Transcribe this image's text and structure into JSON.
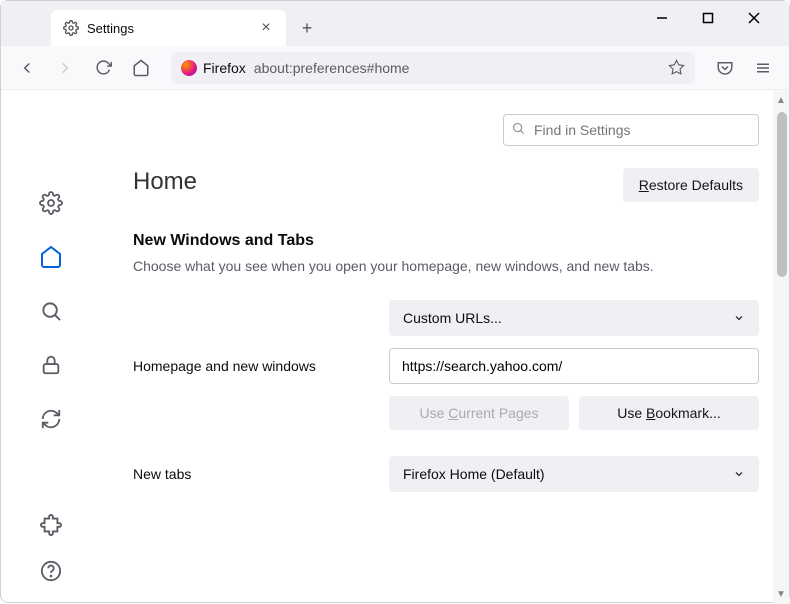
{
  "titlebar": {
    "tab_title": "Settings"
  },
  "navbar": {
    "identity_label": "Firefox",
    "url": "about:preferences#home"
  },
  "search": {
    "placeholder": "Find in Settings"
  },
  "page": {
    "title": "Home",
    "restore_btn": "Restore Defaults",
    "section_heading": "New Windows and Tabs",
    "section_desc": "Choose what you see when you open your homepage, new windows, and new tabs.",
    "homepage_label": "Homepage and new windows",
    "homepage_mode": "Custom URLs...",
    "homepage_url": "https://search.yahoo.com/",
    "use_current": "Use Current Pages",
    "use_bookmark": "Use Bookmark...",
    "newtabs_label": "New tabs",
    "newtabs_mode": "Firefox Home (Default)"
  }
}
